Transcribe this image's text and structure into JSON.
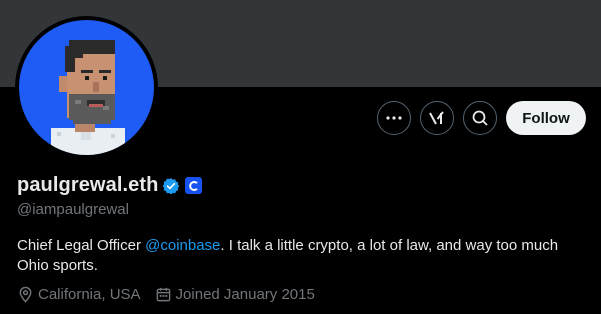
{
  "profile": {
    "display_name": "paulgrewal.eth",
    "handle": "@iampaulgrewal",
    "bio_prefix": "Chief Legal Officer ",
    "bio_mention": "@coinbase",
    "bio_suffix": ". I talk a little crypto, a lot of law, and way too much Ohio sports.",
    "location": "California, USA",
    "joined": "Joined January 2015",
    "verified_color": "#1d9bf0",
    "affiliate_color": "#1652f0"
  },
  "actions": {
    "follow_label": "Follow",
    "more_icon": "more-icon",
    "grok_icon": "grok-icon",
    "search_icon": "search-icon"
  },
  "colors": {
    "banner": "#333639",
    "avatar_bg": "#1f5cf5",
    "background": "#000000",
    "secondary_text": "#71767b",
    "link": "#1d9bf0"
  }
}
